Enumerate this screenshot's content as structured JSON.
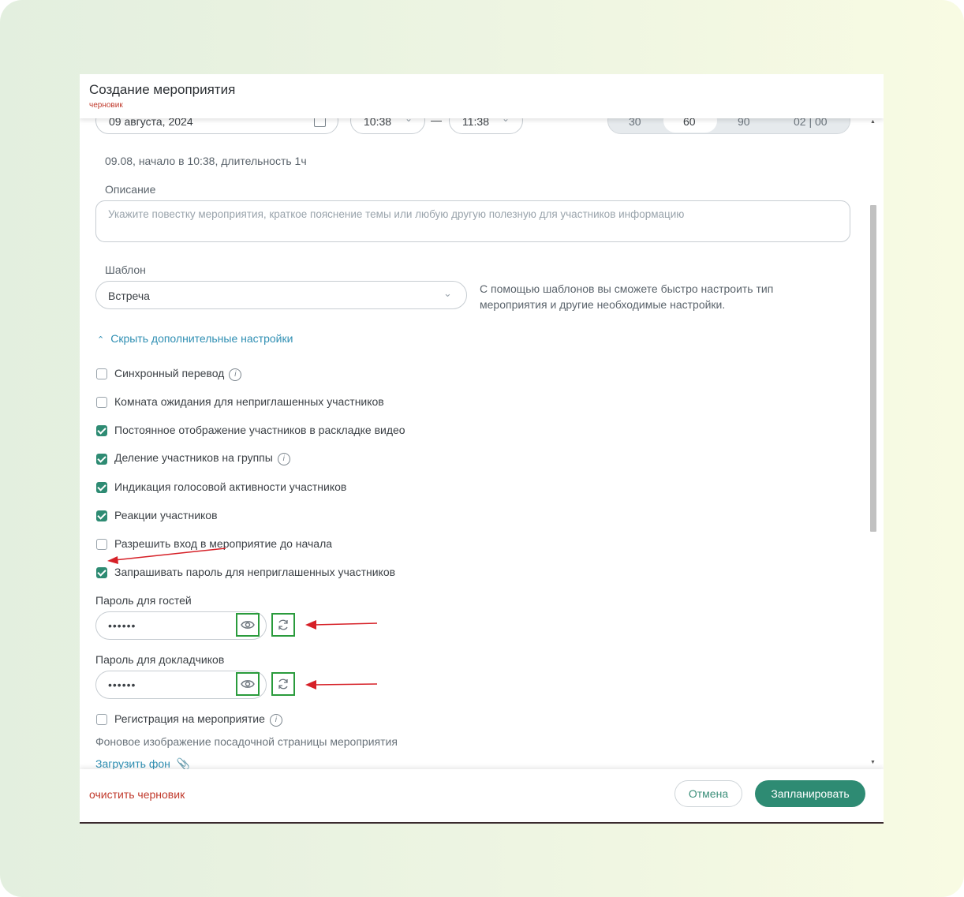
{
  "header": {
    "title": "Создание мероприятия",
    "draft_label": "черновик"
  },
  "date_row": {
    "date": "09 августа, 2024",
    "start_time": "10:38",
    "dash": "—",
    "end_time": "11:38",
    "durations": [
      "30",
      "60",
      "90",
      "02 | 00"
    ],
    "selected_duration": "60"
  },
  "summary": "09.08, начало в 10:38, длительность 1ч",
  "description": {
    "label": "Описание",
    "placeholder": "Укажите повестку мероприятия, краткое пояснение темы или любую другую полезную для участников информацию"
  },
  "template": {
    "label": "Шаблон",
    "value": "Встреча",
    "hint": "С помощью шаблонов вы сможете быстро настроить тип мероприятия и другие необходимые настройки."
  },
  "toggle_advanced": "Скрыть дополнительные настройки",
  "options": [
    {
      "label": "Синхронный перевод",
      "checked": false,
      "info": true
    },
    {
      "label": "Комната ожидания для неприглашенных участников",
      "checked": false,
      "info": false
    },
    {
      "label": "Постоянное отображение участников в раскладке видео",
      "checked": true,
      "info": false
    },
    {
      "label": "Деление участников на группы",
      "checked": true,
      "info": true
    },
    {
      "label": "Индикация голосовой активности участников",
      "checked": true,
      "info": false
    },
    {
      "label": "Реакции участников",
      "checked": true,
      "info": false
    },
    {
      "label": "Разрешить вход в мероприятие до начала",
      "checked": false,
      "info": false
    },
    {
      "label": "Запрашивать пароль для неприглашенных участников",
      "checked": true,
      "info": false
    }
  ],
  "guest_password": {
    "label": "Пароль для гостей",
    "value": "••••••"
  },
  "speaker_password": {
    "label": "Пароль для докладчиков",
    "value": "••••••"
  },
  "registration": {
    "label": "Регистрация на мероприятие",
    "checked": false
  },
  "background": {
    "label": "Фоновое изображение посадочной страницы мероприятия",
    "upload": "Загрузить фон"
  },
  "footer": {
    "clear_draft": "очистить черновик",
    "cancel": "Отмена",
    "schedule": "Запланировать"
  },
  "colors": {
    "accent": "#2e8b73",
    "danger": "#c0392b",
    "highlight": "#2a9b3c",
    "arrow": "#d62027"
  }
}
